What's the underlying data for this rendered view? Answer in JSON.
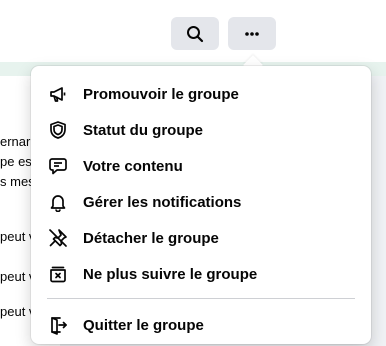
{
  "header": {
    "search_icon": "search-icon",
    "more_icon": "more-horizontal-icon"
  },
  "background_text": {
    "lines": [
      "ernar",
      "pe es",
      "s mes",
      "peut v",
      "peut v",
      "peut v"
    ]
  },
  "menu": {
    "items": [
      {
        "label": "Promouvoir le groupe",
        "icon": "megaphone-icon"
      },
      {
        "label": "Statut du groupe",
        "icon": "shield-icon"
      },
      {
        "label": "Votre contenu",
        "icon": "content-bubble-icon"
      },
      {
        "label": "Gérer les notifications",
        "icon": "bell-icon"
      },
      {
        "label": "Détacher le groupe",
        "icon": "unpin-icon"
      },
      {
        "label": "Ne plus suivre le groupe",
        "icon": "unfollow-icon"
      }
    ],
    "footer_item": {
      "label": "Quitter le groupe",
      "icon": "leave-door-icon"
    }
  },
  "colors": {
    "page_bg": "#f0f2f5",
    "button_bg": "#e4e6eb",
    "menu_bg": "#ffffff",
    "text": "#050505",
    "divider": "#ced0d4"
  }
}
